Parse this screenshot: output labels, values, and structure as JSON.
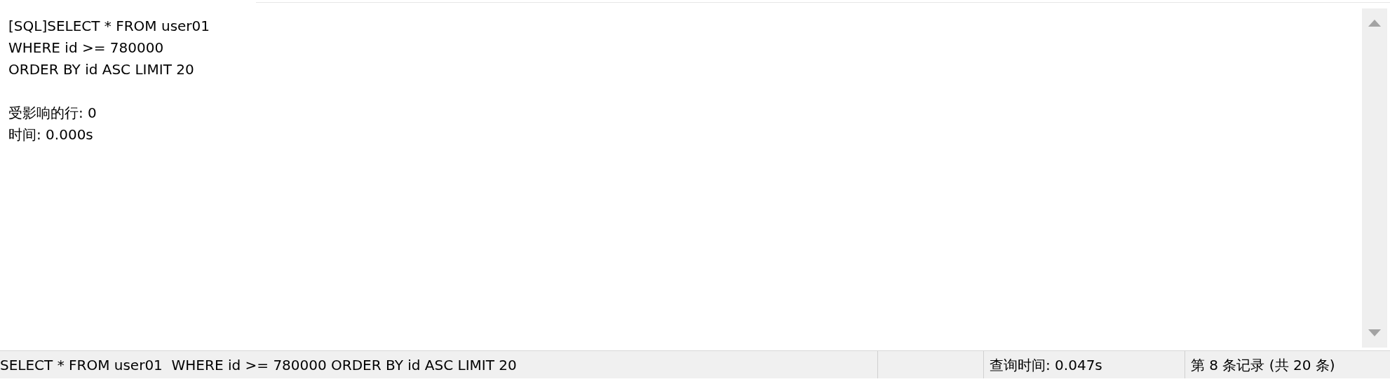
{
  "message_panel": {
    "query_lines": [
      "[SQL]SELECT * FROM user01",
      "WHERE id >= 780000",
      "ORDER BY id ASC LIMIT 20"
    ],
    "result_lines": [
      "受影响的行: 0",
      "时间: 0.000s"
    ]
  },
  "status_bar": {
    "query": "SELECT * FROM user01  WHERE id >= 780000 ORDER BY id ASC LIMIT 20",
    "query_time": "查询时间: 0.047s",
    "record_info": "第 8 条记录 (共 20 条)"
  }
}
